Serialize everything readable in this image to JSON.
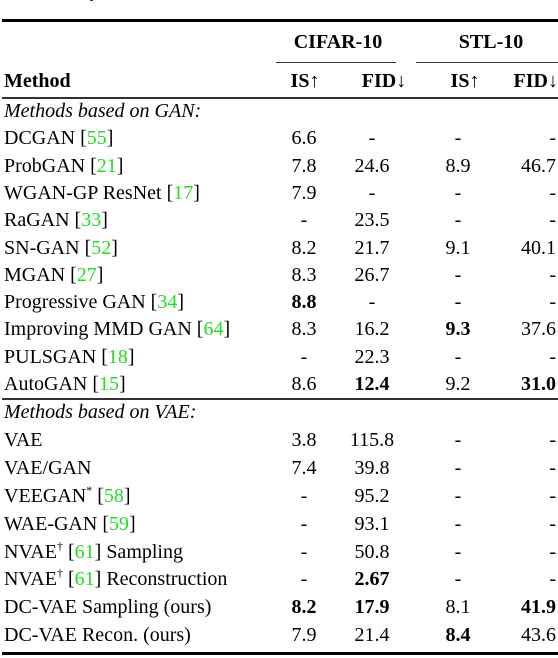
{
  "header": {
    "method_label": "Method",
    "datasets": [
      "CIFAR-10",
      "STL-10"
    ],
    "metrics": [
      "IS↑",
      "FID↓",
      "IS↑",
      "FID↓"
    ]
  },
  "groups": [
    {
      "label": "Methods based on GAN:",
      "rows": [
        {
          "name": "DCGAN",
          "sup": "",
          "cite": "55",
          "suffix": "",
          "values": [
            "6.6",
            "-",
            "-",
            "-"
          ],
          "bold": [
            false,
            false,
            false,
            false
          ]
        },
        {
          "name": "ProbGAN",
          "sup": "",
          "cite": "21",
          "suffix": "",
          "values": [
            "7.8",
            "24.6",
            "8.9",
            "46.7"
          ],
          "bold": [
            false,
            false,
            false,
            false
          ]
        },
        {
          "name": "WGAN-GP ResNet",
          "sup": "",
          "cite": "17",
          "suffix": "",
          "values": [
            "7.9",
            "-",
            "-",
            "-"
          ],
          "bold": [
            false,
            false,
            false,
            false
          ]
        },
        {
          "name": "RaGAN",
          "sup": "",
          "cite": "33",
          "suffix": "",
          "values": [
            "-",
            "23.5",
            "-",
            "-"
          ],
          "bold": [
            false,
            false,
            false,
            false
          ]
        },
        {
          "name": "SN-GAN",
          "sup": "",
          "cite": "52",
          "suffix": "",
          "values": [
            "8.2",
            "21.7",
            "9.1",
            "40.1"
          ],
          "bold": [
            false,
            false,
            false,
            false
          ]
        },
        {
          "name": "MGAN",
          "sup": "",
          "cite": "27",
          "suffix": "",
          "values": [
            "8.3",
            "26.7",
            "-",
            "-"
          ],
          "bold": [
            false,
            false,
            false,
            false
          ]
        },
        {
          "name": "Progressive GAN",
          "sup": "",
          "cite": "34",
          "suffix": "",
          "values": [
            "8.8",
            "-",
            "-",
            "-"
          ],
          "bold": [
            true,
            false,
            false,
            false
          ]
        },
        {
          "name": "Improving MMD GAN",
          "sup": "",
          "cite": "64",
          "suffix": "",
          "values": [
            "8.3",
            "16.2",
            "9.3",
            "37.6"
          ],
          "bold": [
            false,
            false,
            true,
            false
          ]
        },
        {
          "name": "PULSGAN",
          "sup": "",
          "cite": "18",
          "suffix": "",
          "values": [
            "-",
            "22.3",
            "-",
            "-"
          ],
          "bold": [
            false,
            false,
            false,
            false
          ]
        },
        {
          "name": "AutoGAN",
          "sup": "",
          "cite": "15",
          "suffix": "",
          "values": [
            "8.6",
            "12.4",
            "9.2",
            "31.0"
          ],
          "bold": [
            false,
            true,
            false,
            true
          ]
        }
      ]
    },
    {
      "label": "Methods based on VAE:",
      "rows": [
        {
          "name": "VAE",
          "sup": "",
          "cite": "",
          "suffix": "",
          "values": [
            "3.8",
            "115.8",
            "-",
            "-"
          ],
          "bold": [
            false,
            false,
            false,
            false
          ]
        },
        {
          "name": "VAE/GAN",
          "sup": "",
          "cite": "",
          "suffix": "",
          "values": [
            "7.4",
            "39.8",
            "-",
            "-"
          ],
          "bold": [
            false,
            false,
            false,
            false
          ]
        },
        {
          "name": "VEEGAN",
          "sup": "*",
          "cite": "58",
          "suffix": "",
          "values": [
            "-",
            "95.2",
            "-",
            "-"
          ],
          "bold": [
            false,
            false,
            false,
            false
          ]
        },
        {
          "name": "WAE-GAN",
          "sup": "",
          "cite": "59",
          "suffix": "",
          "values": [
            "-",
            "93.1",
            "-",
            "-"
          ],
          "bold": [
            false,
            false,
            false,
            false
          ]
        },
        {
          "name": "NVAE",
          "sup": "†",
          "cite": "61",
          "suffix": "Sampling",
          "values": [
            "-",
            "50.8",
            "-",
            "-"
          ],
          "bold": [
            false,
            false,
            false,
            false
          ]
        },
        {
          "name": "NVAE",
          "sup": "†",
          "cite": "61",
          "suffix": "Reconstruction",
          "values": [
            "-",
            "2.67",
            "-",
            "-"
          ],
          "bold": [
            false,
            true,
            false,
            false
          ]
        },
        {
          "name": "DC-VAE Sampling (ours)",
          "sup": "",
          "cite": "",
          "suffix": "",
          "values": [
            "8.2",
            "17.9",
            "8.1",
            "41.9"
          ],
          "bold": [
            true,
            true,
            false,
            true
          ]
        },
        {
          "name": "DC-VAE Recon. (ours)",
          "sup": "",
          "cite": "",
          "suffix": "",
          "values": [
            "7.9",
            "21.4",
            "8.4",
            "43.6"
          ],
          "bold": [
            false,
            false,
            true,
            false
          ]
        }
      ]
    }
  ],
  "colors": {
    "citation": "#22dd22",
    "text": "#000000"
  }
}
